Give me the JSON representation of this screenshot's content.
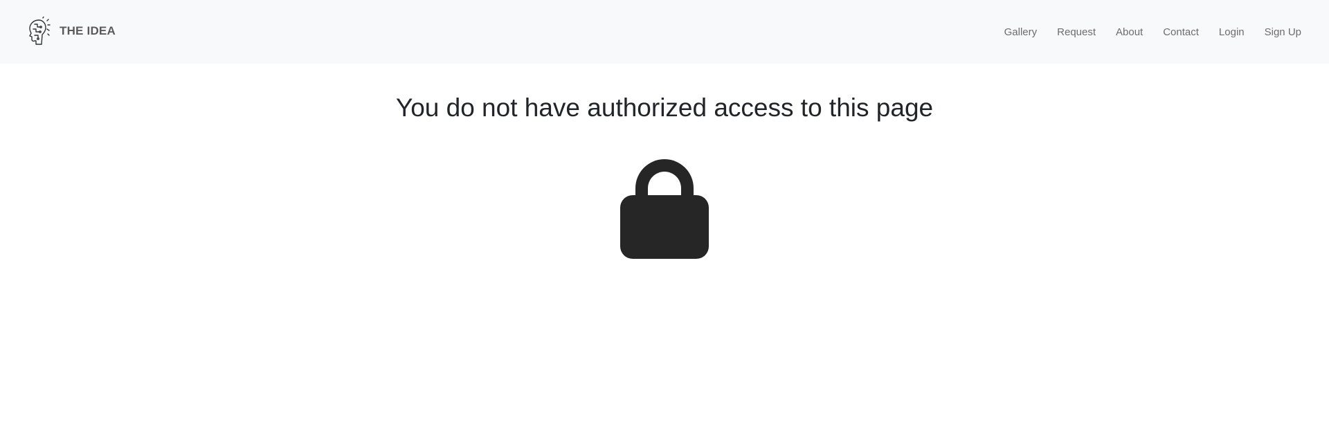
{
  "brand": {
    "name": "THE IDEA"
  },
  "nav": {
    "items": [
      {
        "label": "Gallery"
      },
      {
        "label": "Request"
      },
      {
        "label": "About"
      },
      {
        "label": "Contact"
      },
      {
        "label": "Login"
      },
      {
        "label": "Sign Up"
      }
    ]
  },
  "main": {
    "title": "You do not have authorized access to this page",
    "icon": "lock-icon"
  },
  "colors": {
    "navbar_bg": "#f8f9fa",
    "text": "#212529",
    "nav_link": "#6c6c6c",
    "icon": "#262626"
  }
}
